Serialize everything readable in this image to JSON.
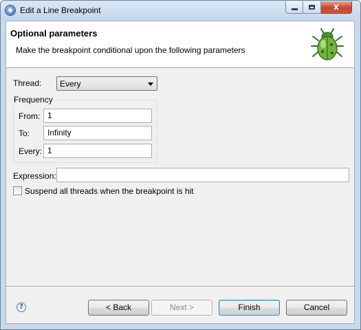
{
  "window": {
    "title": "Edit a Line Breakpoint",
    "close_glyph": "x"
  },
  "header": {
    "title": "Optional parameters",
    "description": "Make the breakpoint conditional upon the following parameters",
    "icon": "bug-icon"
  },
  "thread": {
    "label": "Thread:",
    "selected": "Every"
  },
  "frequency": {
    "group_label": "Frequency",
    "from_label": "From:",
    "from_value": "1",
    "to_label": "To:",
    "to_value": "Infinity",
    "every_label": "Every:",
    "every_value": "1"
  },
  "expression": {
    "label": "Expression:",
    "value": ""
  },
  "suspend": {
    "label": "Suspend all threads when the breakpoint is hit",
    "checked": false
  },
  "footer": {
    "help_glyph": "?",
    "back_label": "< Back",
    "next_label": "Next >",
    "finish_label": "Finish",
    "cancel_label": "Cancel"
  }
}
